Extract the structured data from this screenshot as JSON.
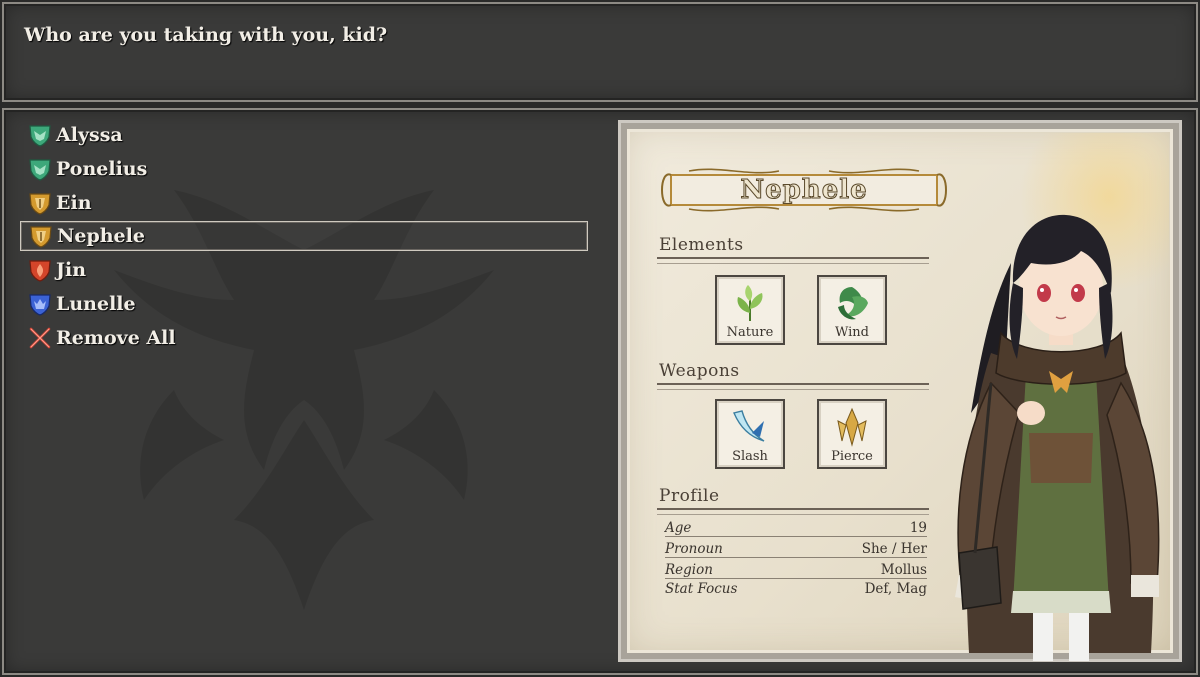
{
  "message": {
    "text": "Who are you taking with you, kid?"
  },
  "party": {
    "members": [
      {
        "label": "Alyssa",
        "icon": "green-shield-icon",
        "color": "#3da87a"
      },
      {
        "label": "Ponelius",
        "icon": "green-shield-icon",
        "color": "#3da87a"
      },
      {
        "label": "Ein",
        "icon": "gold-shield-icon",
        "color": "#d49a2e"
      },
      {
        "label": "Nephele",
        "icon": "gold-shield-icon",
        "color": "#d49a2e"
      },
      {
        "label": "Jin",
        "icon": "red-shield-icon",
        "color": "#d4452a"
      },
      {
        "label": "Lunelle",
        "icon": "blue-shield-icon",
        "color": "#3b62d4"
      }
    ],
    "selected": "Nephele",
    "remove_all_label": "Remove All"
  },
  "profile": {
    "name": "Nephele",
    "elements_title": "Elements",
    "elements": [
      {
        "label": "Nature",
        "icon": "nature-icon"
      },
      {
        "label": "Wind",
        "icon": "wind-icon"
      }
    ],
    "weapons_title": "Weapons",
    "weapons": [
      {
        "label": "Slash",
        "icon": "slash-icon"
      },
      {
        "label": "Pierce",
        "icon": "pierce-icon"
      }
    ],
    "profile_title": "Profile",
    "rows": [
      {
        "key": "Age",
        "value": "19"
      },
      {
        "key": "Pronoun",
        "value": "She / Her"
      },
      {
        "key": "Region",
        "value": "Mollus"
      },
      {
        "key": "Stat Focus",
        "value": "Def, Mag"
      }
    ]
  }
}
